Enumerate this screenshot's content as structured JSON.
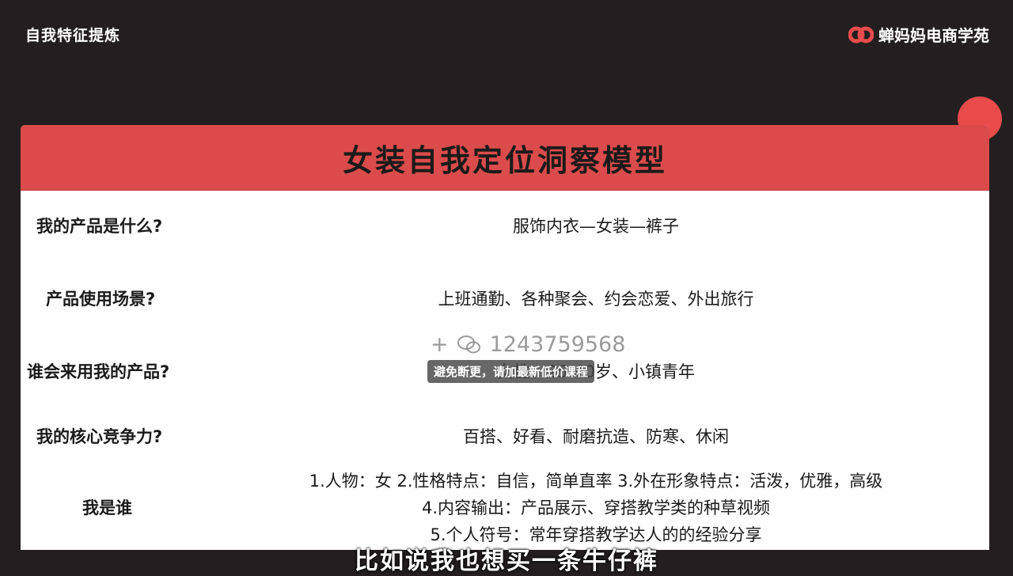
{
  "header": {
    "section_title": "自我特征提炼",
    "brand_name": "蝉妈妈电商学苑"
  },
  "card": {
    "title": "女装自我定位洞察模型",
    "rows": [
      {
        "question": "我的产品是什么?",
        "answer": "服饰内衣—女装—裤子"
      },
      {
        "question": "产品使用场景?",
        "answer": "上班通勤、各种聚会、约会恋爱、外出旅行"
      },
      {
        "question": "谁会来用我的产品?",
        "answer": "女性、25-40岁、小镇青年"
      },
      {
        "question": "我的核心竞争力?",
        "answer": "百搭、好看、耐磨抗造、防寒、休闲"
      }
    ],
    "who": {
      "question": "我是谁",
      "lines": [
        "1.人物：女    2.性格特点：自信，简单直率    3.外在形象特点：活泼，优雅，高级",
        "4.内容输出：产品展示、穿搭教学类的种草视频",
        "5.个人符号：常年穿搭教学达人的的经验分享"
      ]
    }
  },
  "overlay": {
    "watermark_prefix": "+",
    "watermark_number": "1243759568",
    "notice": "避免断更，请加最新低价课程"
  },
  "subtitle": "比如说我也想买一条牛仔裤",
  "colors": {
    "background": "#231f20",
    "accent_red": "#dc4b4b",
    "card": "#ffffff"
  }
}
